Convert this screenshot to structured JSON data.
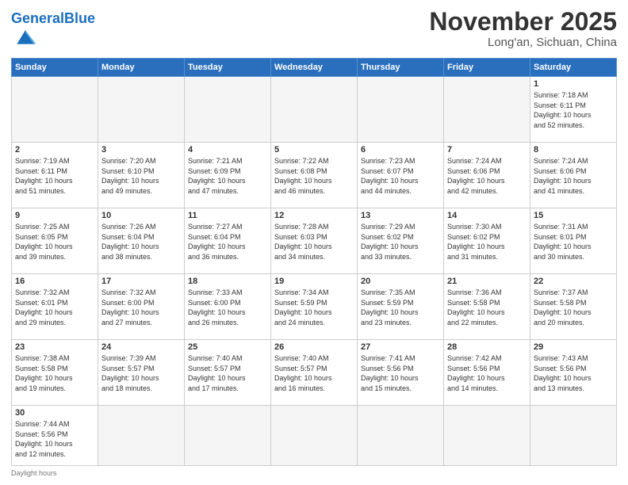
{
  "header": {
    "logo_general": "General",
    "logo_blue": "Blue",
    "month_title": "November 2025",
    "location": "Long'an, Sichuan, China"
  },
  "weekdays": [
    "Sunday",
    "Monday",
    "Tuesday",
    "Wednesday",
    "Thursday",
    "Friday",
    "Saturday"
  ],
  "weeks": [
    [
      {
        "day": "",
        "info": ""
      },
      {
        "day": "",
        "info": ""
      },
      {
        "day": "",
        "info": ""
      },
      {
        "day": "",
        "info": ""
      },
      {
        "day": "",
        "info": ""
      },
      {
        "day": "",
        "info": ""
      },
      {
        "day": "1",
        "info": "Sunrise: 7:18 AM\nSunset: 6:11 PM\nDaylight: 10 hours\nand 52 minutes."
      }
    ],
    [
      {
        "day": "2",
        "info": "Sunrise: 7:19 AM\nSunset: 6:11 PM\nDaylight: 10 hours\nand 51 minutes."
      },
      {
        "day": "3",
        "info": "Sunrise: 7:20 AM\nSunset: 6:10 PM\nDaylight: 10 hours\nand 49 minutes."
      },
      {
        "day": "4",
        "info": "Sunrise: 7:21 AM\nSunset: 6:09 PM\nDaylight: 10 hours\nand 47 minutes."
      },
      {
        "day": "5",
        "info": "Sunrise: 7:22 AM\nSunset: 6:08 PM\nDaylight: 10 hours\nand 46 minutes."
      },
      {
        "day": "6",
        "info": "Sunrise: 7:23 AM\nSunset: 6:07 PM\nDaylight: 10 hours\nand 44 minutes."
      },
      {
        "day": "7",
        "info": "Sunrise: 7:24 AM\nSunset: 6:06 PM\nDaylight: 10 hours\nand 42 minutes."
      },
      {
        "day": "8",
        "info": "Sunrise: 7:24 AM\nSunset: 6:06 PM\nDaylight: 10 hours\nand 41 minutes."
      }
    ],
    [
      {
        "day": "9",
        "info": "Sunrise: 7:25 AM\nSunset: 6:05 PM\nDaylight: 10 hours\nand 39 minutes."
      },
      {
        "day": "10",
        "info": "Sunrise: 7:26 AM\nSunset: 6:04 PM\nDaylight: 10 hours\nand 38 minutes."
      },
      {
        "day": "11",
        "info": "Sunrise: 7:27 AM\nSunset: 6:04 PM\nDaylight: 10 hours\nand 36 minutes."
      },
      {
        "day": "12",
        "info": "Sunrise: 7:28 AM\nSunset: 6:03 PM\nDaylight: 10 hours\nand 34 minutes."
      },
      {
        "day": "13",
        "info": "Sunrise: 7:29 AM\nSunset: 6:02 PM\nDaylight: 10 hours\nand 33 minutes."
      },
      {
        "day": "14",
        "info": "Sunrise: 7:30 AM\nSunset: 6:02 PM\nDaylight: 10 hours\nand 31 minutes."
      },
      {
        "day": "15",
        "info": "Sunrise: 7:31 AM\nSunset: 6:01 PM\nDaylight: 10 hours\nand 30 minutes."
      }
    ],
    [
      {
        "day": "16",
        "info": "Sunrise: 7:32 AM\nSunset: 6:01 PM\nDaylight: 10 hours\nand 29 minutes."
      },
      {
        "day": "17",
        "info": "Sunrise: 7:32 AM\nSunset: 6:00 PM\nDaylight: 10 hours\nand 27 minutes."
      },
      {
        "day": "18",
        "info": "Sunrise: 7:33 AM\nSunset: 6:00 PM\nDaylight: 10 hours\nand 26 minutes."
      },
      {
        "day": "19",
        "info": "Sunrise: 7:34 AM\nSunset: 5:59 PM\nDaylight: 10 hours\nand 24 minutes."
      },
      {
        "day": "20",
        "info": "Sunrise: 7:35 AM\nSunset: 5:59 PM\nDaylight: 10 hours\nand 23 minutes."
      },
      {
        "day": "21",
        "info": "Sunrise: 7:36 AM\nSunset: 5:58 PM\nDaylight: 10 hours\nand 22 minutes."
      },
      {
        "day": "22",
        "info": "Sunrise: 7:37 AM\nSunset: 5:58 PM\nDaylight: 10 hours\nand 20 minutes."
      }
    ],
    [
      {
        "day": "23",
        "info": "Sunrise: 7:38 AM\nSunset: 5:58 PM\nDaylight: 10 hours\nand 19 minutes."
      },
      {
        "day": "24",
        "info": "Sunrise: 7:39 AM\nSunset: 5:57 PM\nDaylight: 10 hours\nand 18 minutes."
      },
      {
        "day": "25",
        "info": "Sunrise: 7:40 AM\nSunset: 5:57 PM\nDaylight: 10 hours\nand 17 minutes."
      },
      {
        "day": "26",
        "info": "Sunrise: 7:40 AM\nSunset: 5:57 PM\nDaylight: 10 hours\nand 16 minutes."
      },
      {
        "day": "27",
        "info": "Sunrise: 7:41 AM\nSunset: 5:56 PM\nDaylight: 10 hours\nand 15 minutes."
      },
      {
        "day": "28",
        "info": "Sunrise: 7:42 AM\nSunset: 5:56 PM\nDaylight: 10 hours\nand 14 minutes."
      },
      {
        "day": "29",
        "info": "Sunrise: 7:43 AM\nSunset: 5:56 PM\nDaylight: 10 hours\nand 13 minutes."
      }
    ],
    [
      {
        "day": "30",
        "info": "Sunrise: 7:44 AM\nSunset: 5:56 PM\nDaylight: 10 hours\nand 12 minutes."
      },
      {
        "day": "",
        "info": ""
      },
      {
        "day": "",
        "info": ""
      },
      {
        "day": "",
        "info": ""
      },
      {
        "day": "",
        "info": ""
      },
      {
        "day": "",
        "info": ""
      },
      {
        "day": "",
        "info": ""
      }
    ]
  ],
  "footer": {
    "daylight_label": "Daylight hours"
  }
}
